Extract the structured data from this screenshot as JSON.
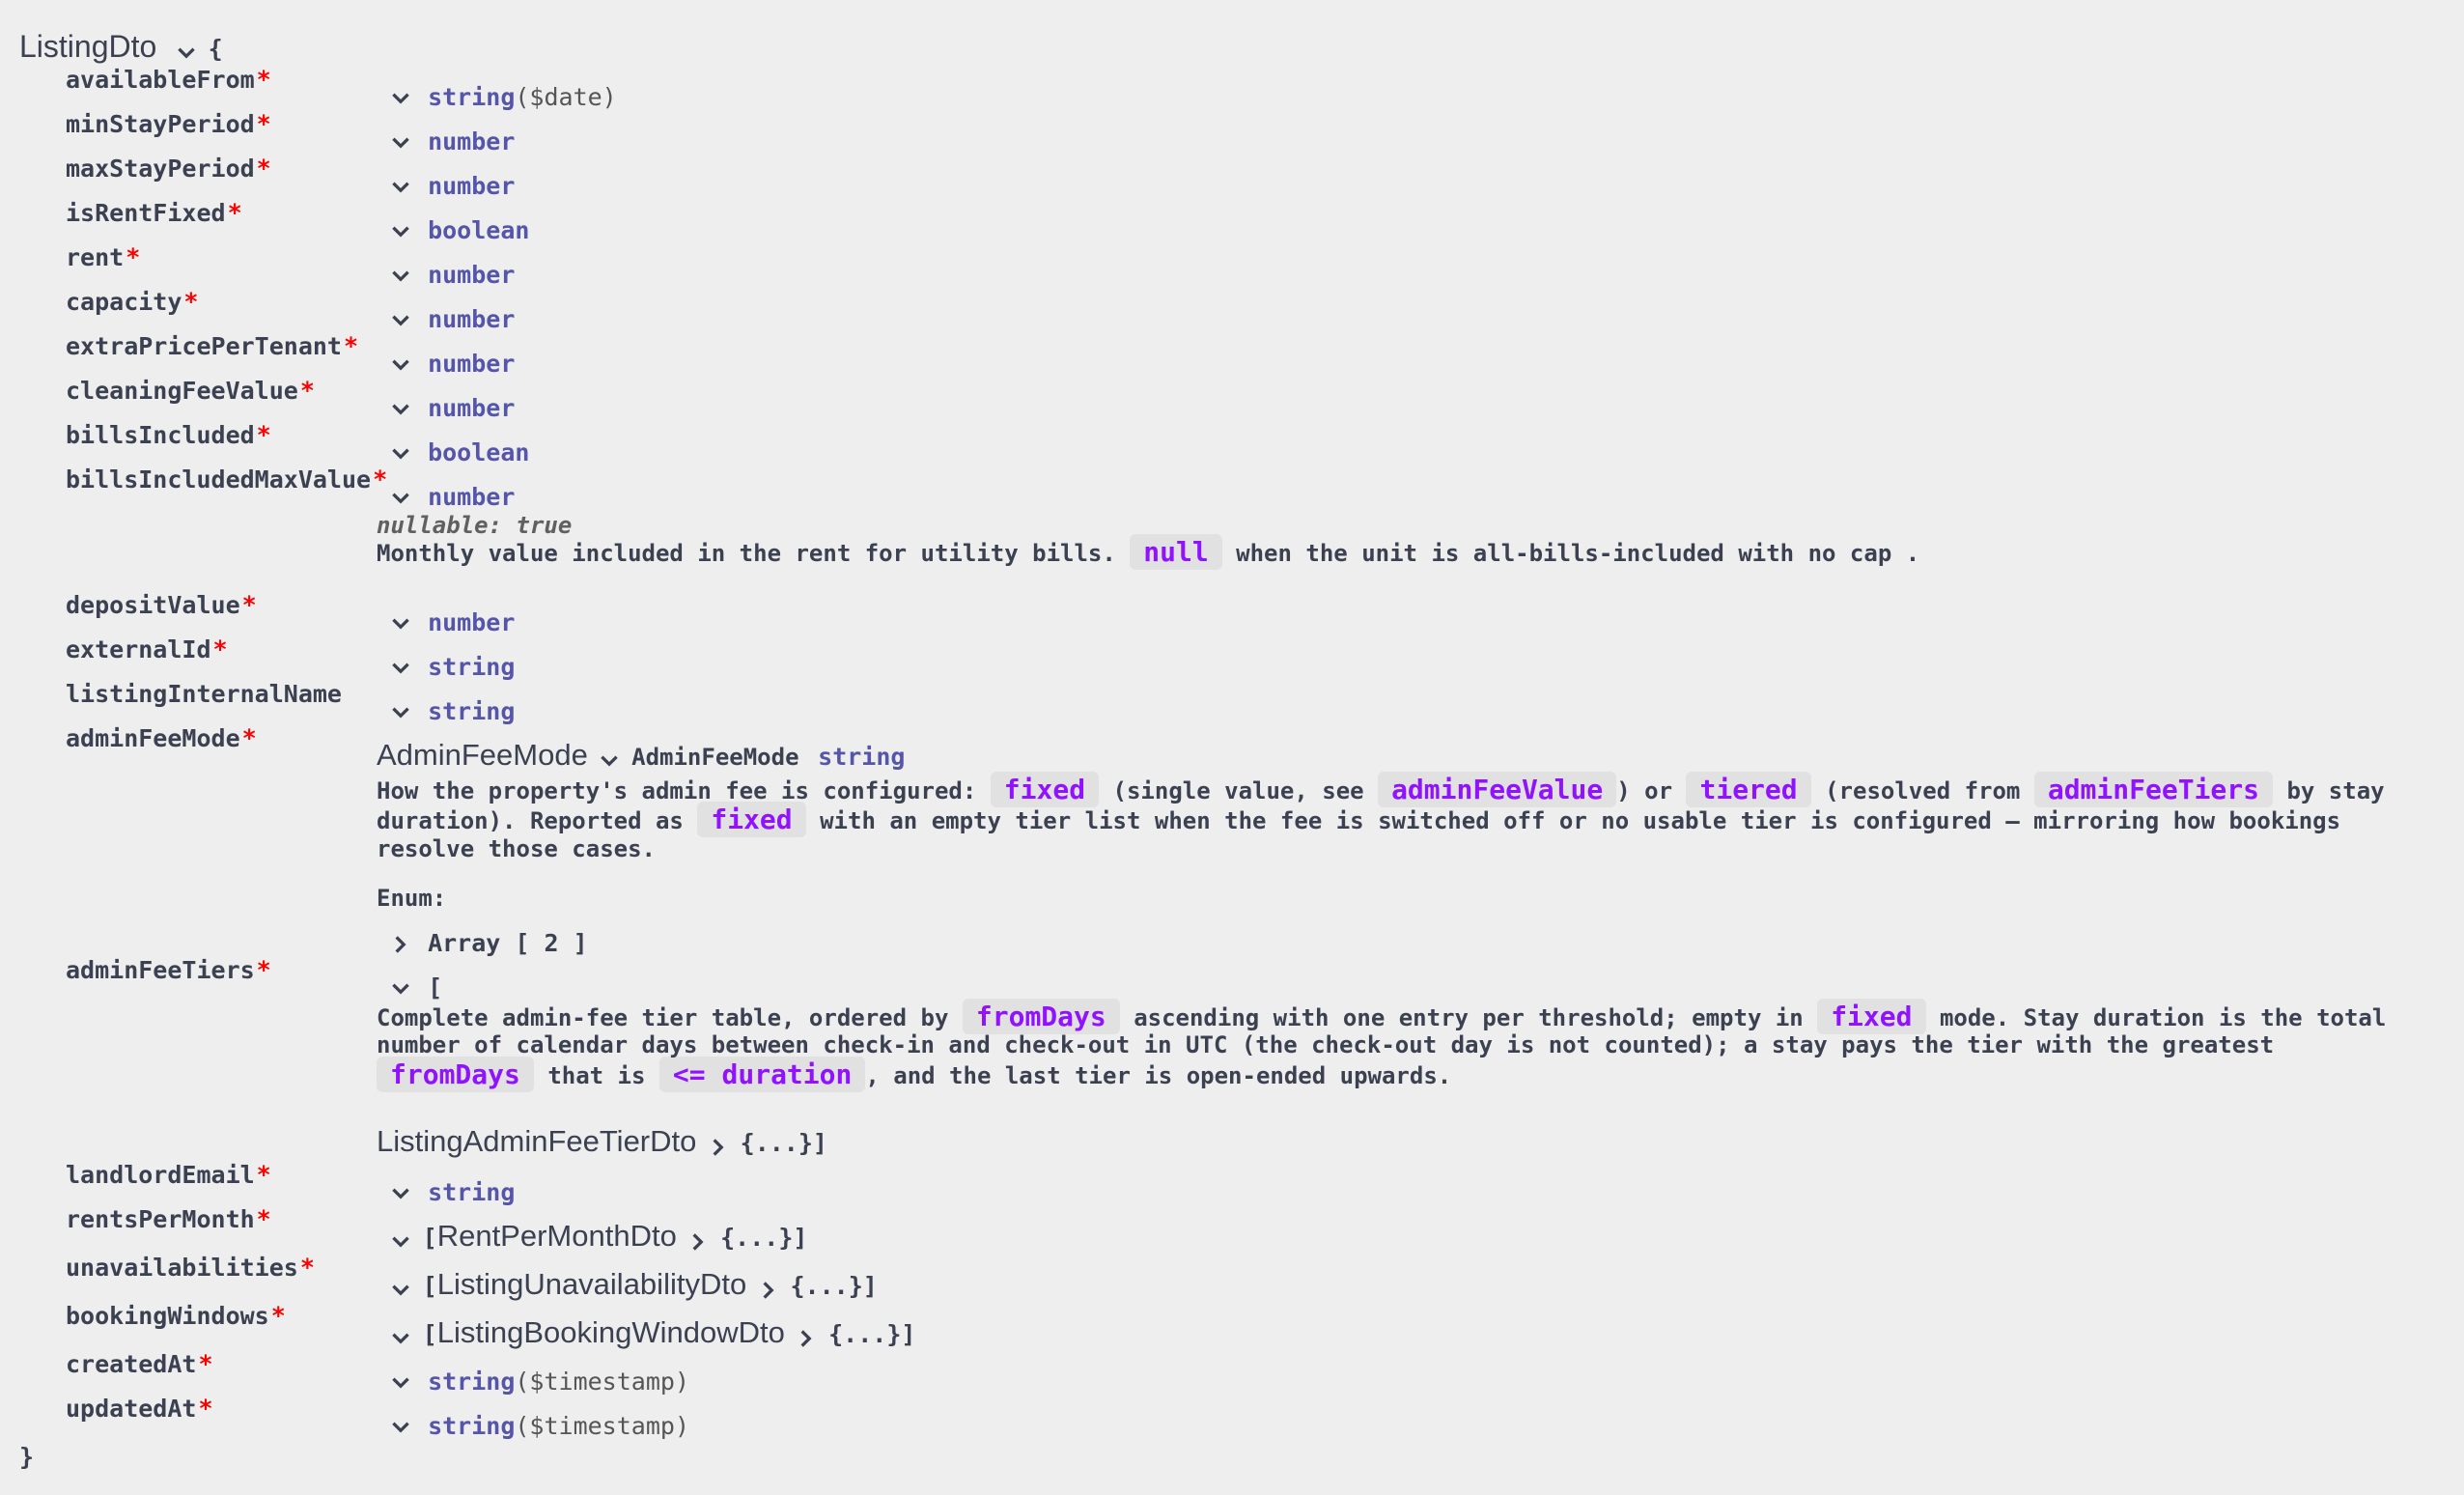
{
  "model": {
    "title": "ListingDto",
    "open_brace": "{",
    "close_brace": "}"
  },
  "properties": [
    {
      "name": "availableFrom",
      "type": "string",
      "format": "($date)",
      "required": true
    },
    {
      "name": "minStayPeriod",
      "type": "number",
      "required": true
    },
    {
      "name": "maxStayPeriod",
      "type": "number",
      "required": true
    },
    {
      "name": "isRentFixed",
      "type": "boolean",
      "required": true
    },
    {
      "name": "rent",
      "type": "number",
      "required": true
    },
    {
      "name": "capacity",
      "type": "number",
      "required": true
    },
    {
      "name": "extraPricePerTenant",
      "type": "number",
      "required": true
    },
    {
      "name": "cleaningFeeValue",
      "type": "number",
      "required": true
    },
    {
      "name": "billsIncluded",
      "type": "boolean",
      "required": true
    },
    {
      "name": "billsIncludedMaxValue",
      "type": "number",
      "required": true
    },
    {
      "name": "depositValue",
      "type": "number",
      "required": true
    },
    {
      "name": "externalId",
      "type": "string",
      "required": true
    },
    {
      "name": "listingInternalName",
      "type": "string",
      "required": false
    },
    {
      "name": "adminFeeMode",
      "required": true
    },
    {
      "name": "adminFeeTiers",
      "required": true
    },
    {
      "name": "landlordEmail",
      "type": "string",
      "required": true
    },
    {
      "name": "rentsPerMonth",
      "required": true
    },
    {
      "name": "unavailabilities",
      "required": true
    },
    {
      "name": "bookingWindows",
      "required": true
    },
    {
      "name": "createdAt",
      "type": "string",
      "format": "($timestamp)",
      "required": true
    },
    {
      "name": "updatedAt",
      "type": "string",
      "format": "($timestamp)",
      "required": true
    }
  ],
  "required_mark": "*",
  "bills": {
    "nullable": "nullable: true",
    "desc_a": "Monthly value included in the rent for utility bills.",
    "code_null": "null",
    "desc_b": "when the unit is all-bills-included with no cap ."
  },
  "admin_fee_mode": {
    "title": "AdminFeeMode",
    "inner_name": "AdminFeeMode",
    "type": "string",
    "l1_a": "How the property's admin fee is configured:",
    "code_fixed": "fixed",
    "l1_b": "(single value, see",
    "code_value": "adminFeeValue",
    "l1_c": ") or",
    "code_tiered": "tiered",
    "l1_d": "(resolved from",
    "code_tiers": "adminFeeTiers",
    "l1_e": "by stay",
    "l2_a": "duration). Reported as",
    "l2_b": "with an empty tier list when the fee is switched off or no usable tier is configured — mirroring how bookings",
    "l3": "resolve those cases.",
    "enum_label": "Enum:",
    "enum_array": "Array [ 2 ]"
  },
  "admin_fee_tiers": {
    "open": "[",
    "l1_a": "Complete admin-fee tier table, ordered by",
    "code_fromdays": "fromDays",
    "l1_b": "ascending with one entry per threshold; empty in",
    "code_fixed": "fixed",
    "l1_c": "mode. Stay duration is the total",
    "l2": "number of calendar days between check-in and check-out in UTC (the check-out day is not counted); a stay pays the tier with the greatest",
    "l3_a": "that is",
    "code_duration": "<= duration",
    "l3_b": ", and the last tier is open-ended upwards.",
    "item_model": "ListingAdminFeeTierDto",
    "item_collapsed": "{...}]"
  },
  "arrays": {
    "rents_model": "RentPerMonthDto",
    "unavail_model": "ListingUnavailabilityDto",
    "booking_model": "ListingBookingWindowDto",
    "open": "[",
    "collapsed": "{...}]"
  },
  "icons": {
    "expanded": "chevron-down-icon",
    "collapsed": "chevron-right-icon"
  },
  "colors": {
    "type": "#55aa",
    "code": "#9012fe",
    "required": "#ff0000",
    "background": "#eeeeee"
  }
}
